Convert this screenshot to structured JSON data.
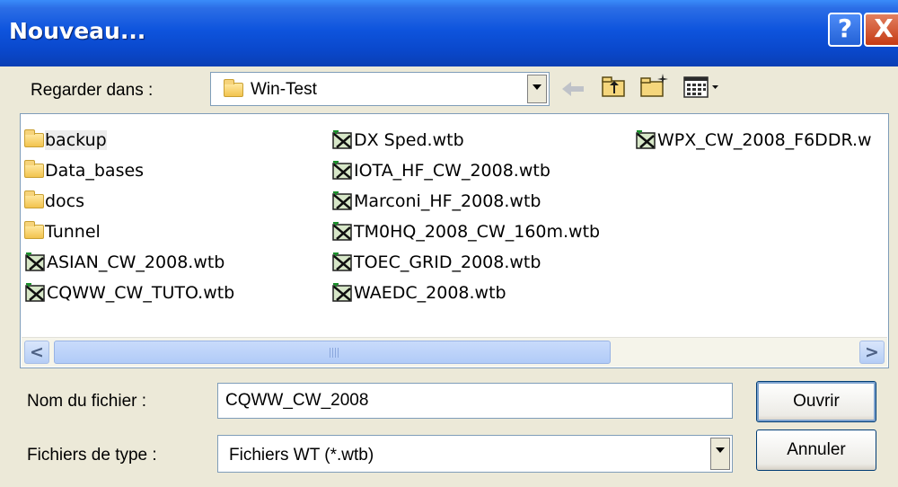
{
  "window": {
    "title": "Nouveau...",
    "help_glyph": "?",
    "close_glyph": "X"
  },
  "lookin": {
    "label": "Regarder dans :",
    "folder": "Win-Test"
  },
  "files": {
    "col1": [
      {
        "name": "backup",
        "type": "folder",
        "selected": true
      },
      {
        "name": "Data_bases",
        "type": "folder"
      },
      {
        "name": "docs",
        "type": "folder"
      },
      {
        "name": "Tunnel",
        "type": "folder"
      },
      {
        "name": "ASIAN_CW_2008.wtb",
        "type": "wtb"
      },
      {
        "name": "CQWW_CW_TUTO.wtb",
        "type": "wtb"
      }
    ],
    "col2": [
      {
        "name": "DX Sped.wtb",
        "type": "wtb"
      },
      {
        "name": "IOTA_HF_CW_2008.wtb",
        "type": "wtb"
      },
      {
        "name": "Marconi_HF_2008.wtb",
        "type": "wtb"
      },
      {
        "name": "TM0HQ_2008_CW_160m.wtb",
        "type": "wtb"
      },
      {
        "name": "TOEC_GRID_2008.wtb",
        "type": "wtb"
      },
      {
        "name": "WAEDC_2008.wtb",
        "type": "wtb"
      }
    ],
    "col3": [
      {
        "name": "WPX_CW_2008_F6DDR.w",
        "type": "wtb"
      }
    ]
  },
  "scroll": {
    "left_glyph": "<",
    "right_glyph": ">"
  },
  "filename": {
    "label": "Nom du fichier :",
    "value": "CQWW_CW_2008"
  },
  "filetype": {
    "label": "Fichiers de type :",
    "value": "Fichiers WT (*.wtb)"
  },
  "buttons": {
    "open": "Ouvrir",
    "cancel": "Annuler"
  }
}
